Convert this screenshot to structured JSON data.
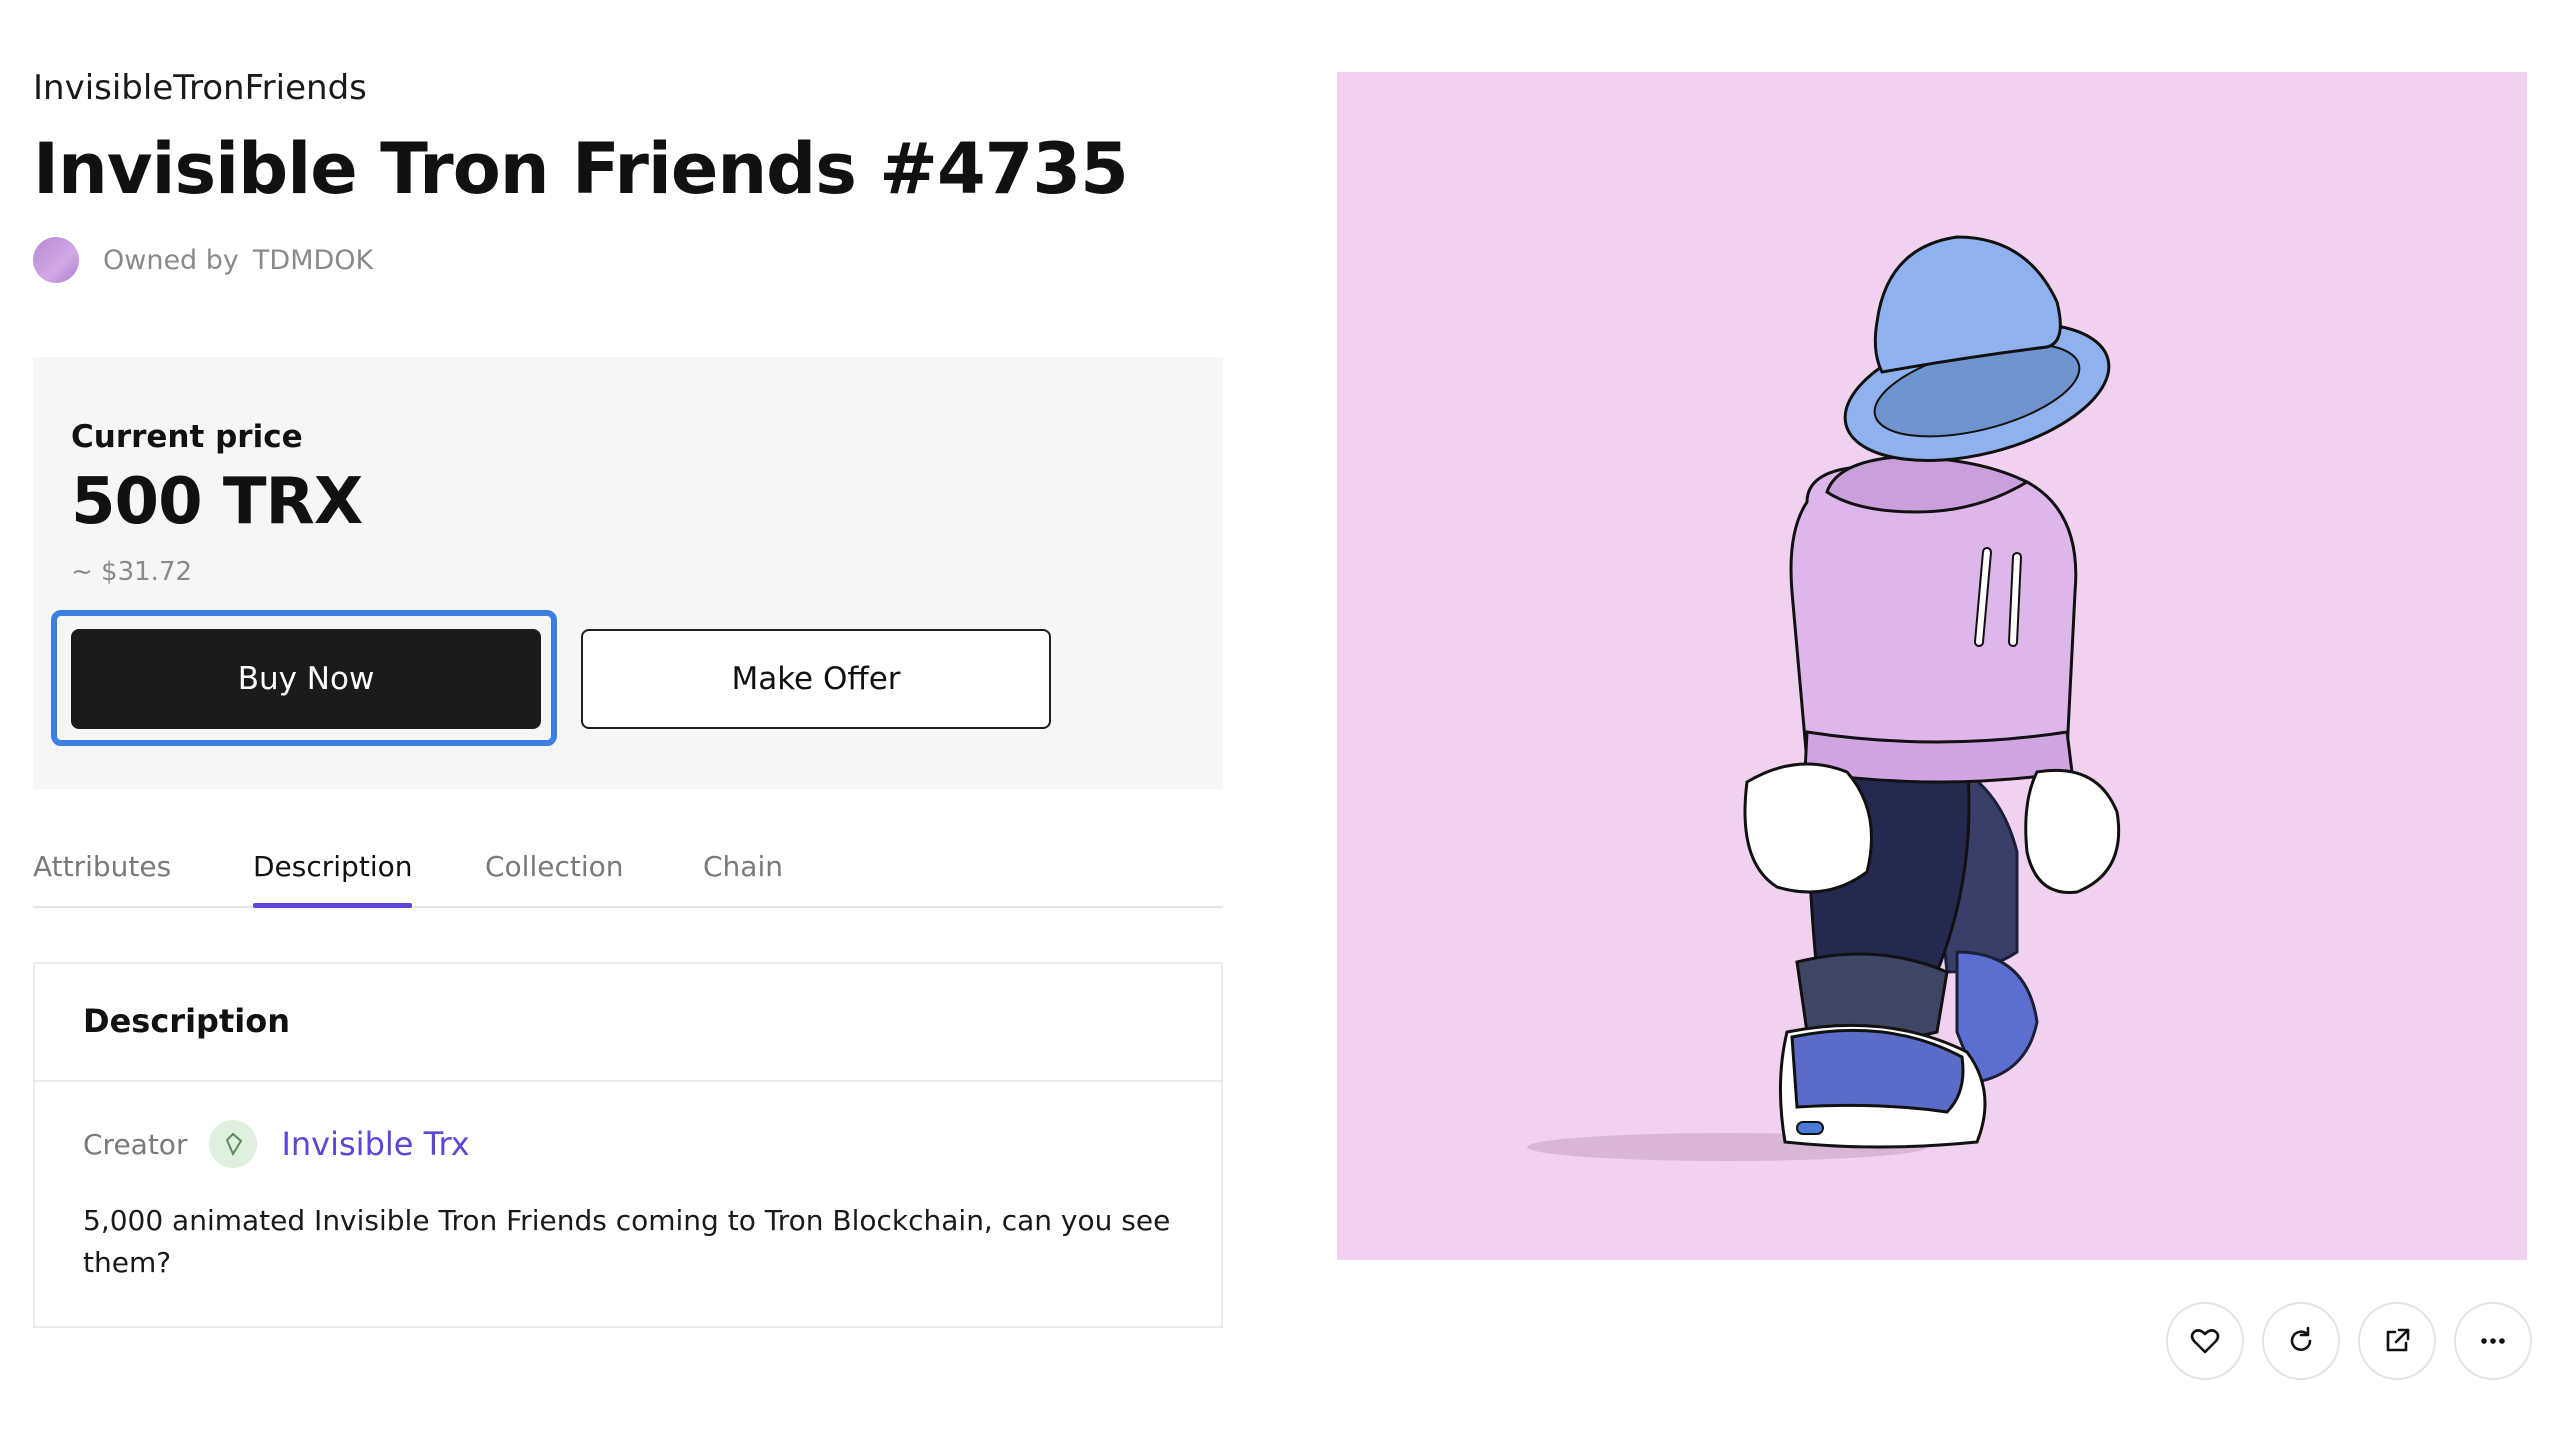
{
  "header": {
    "collection_name": "InvisibleTronFriends",
    "title": "Invisible Tron Friends #4735",
    "owner_label": "Owned by",
    "owner_name": "TDMDOK"
  },
  "price": {
    "label": "Current price",
    "value": "500 TRX",
    "usd": "~ $31.72",
    "buy_label": "Buy Now",
    "offer_label": "Make Offer"
  },
  "tabs": [
    {
      "label": "Attributes",
      "active": false
    },
    {
      "label": "Description",
      "active": true
    },
    {
      "label": "Collection",
      "active": false
    },
    {
      "label": "Chain",
      "active": false
    }
  ],
  "description": {
    "title": "Description",
    "creator_label": "Creator",
    "creator_name": "Invisible Trx",
    "text": "5,000 animated Invisible Tron Friends coming to Tron Blockchain, can you see them?"
  },
  "image": {
    "background_color": "#f0d1ef",
    "subject": "invisible-character-bucket-hat-hoodie"
  },
  "actions": [
    {
      "icon": "heart-icon"
    },
    {
      "icon": "refresh-icon"
    },
    {
      "icon": "external-link-icon"
    },
    {
      "icon": "more-icon"
    }
  ],
  "colors": {
    "accent": "#5b46d6",
    "focus_ring": "#3b7fe0",
    "primary_button": "#1b1b1b"
  }
}
